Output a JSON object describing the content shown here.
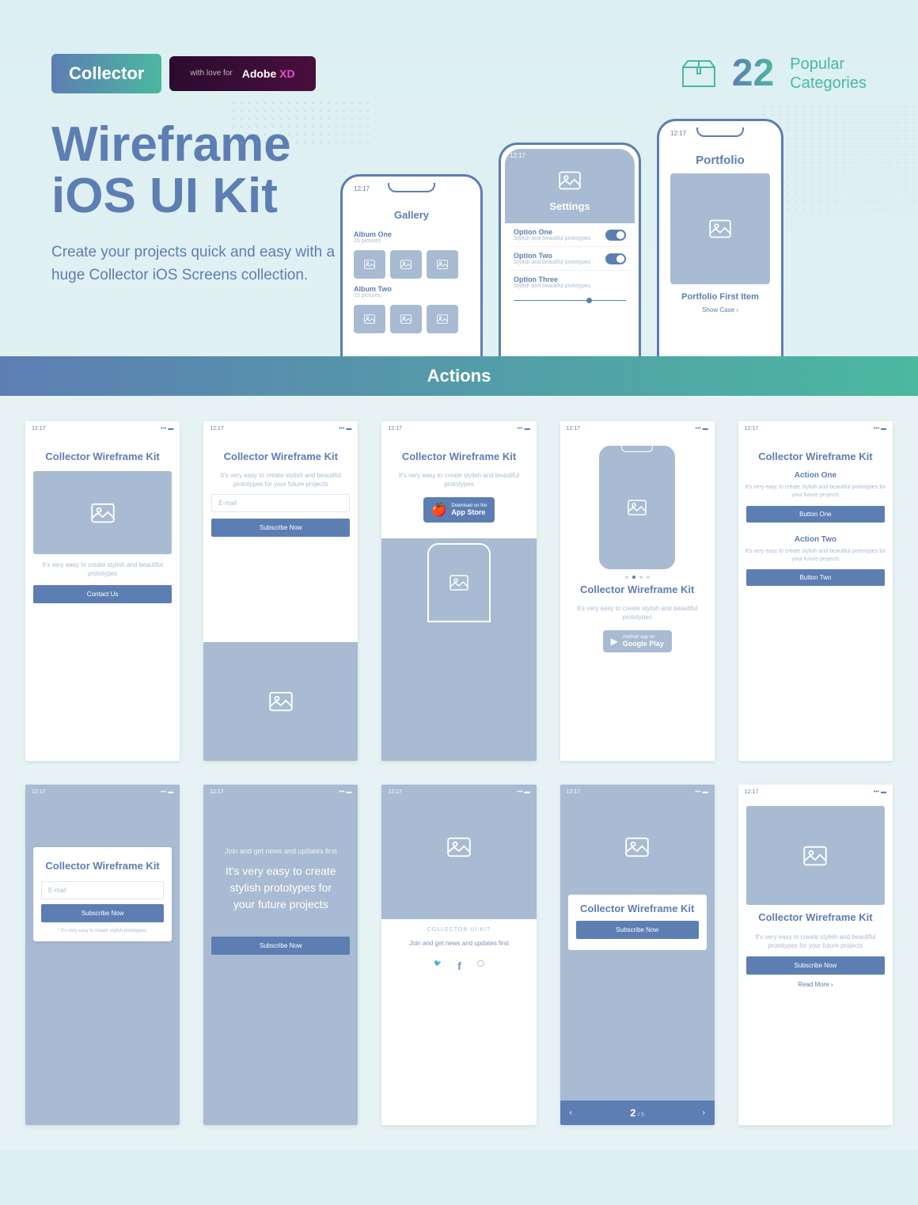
{
  "badges": {
    "collector": "Collector",
    "love": "with love for",
    "adobe": "Adobe",
    "xd": "XD"
  },
  "hero": {
    "count": "22",
    "cat1": "Popular",
    "cat2": "Categories",
    "title1": "Wireframe",
    "title2": "iOS UI Kit",
    "sub": "Create your projects quick and easy with a huge Collector iOS Screens collection."
  },
  "phones": {
    "time": "12:17",
    "gallery": "Gallery",
    "album1": "Album One",
    "album2": "Album Two",
    "pics": "15 pictures",
    "settings": "Settings",
    "opt1": "Option One",
    "opt2": "Option Two",
    "opt3": "Option Three",
    "optsub": "Stylish and beautiful prototypes",
    "portfolio": "Portfolio",
    "portitem": "Portfolio First Item",
    "showcase": "Show Case  ›"
  },
  "section": "Actions",
  "common": {
    "title": "Collector Wireframe Kit",
    "sub": "It's very easy to create stylish and beautiful prototypes",
    "subfuture": "It's very easy to create stylish and beautiful prototypes for your future projects",
    "email": "E-mail",
    "contact": "Contact Us",
    "subscribe": "Subscribe Now",
    "appstore_t": "Download on the",
    "appstore": "App Store",
    "play_t": "Android app on",
    "play": "Google Play",
    "action1": "Action One",
    "action2": "Action Two",
    "btn1": "Button One",
    "btn2": "Button Two",
    "joinsmall": "Join and get news and updates first",
    "joinbig": "It's very easy to create stylish prototypes for your future projects",
    "note": "* It's very easy to create stylish prototypes.",
    "kit": "COLLECTOR UI KIT",
    "join2": "Join and get news and updates first",
    "page": "2",
    "pagesuf": "/ 5",
    "readmore": "Read More  ›"
  }
}
